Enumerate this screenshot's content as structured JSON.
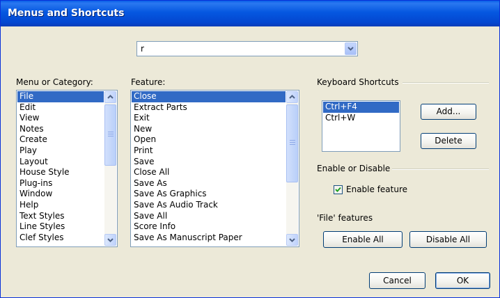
{
  "window": {
    "title": "Menus and Shortcuts"
  },
  "search": {
    "value": "r"
  },
  "menu_list": {
    "label": "Menu or Category:",
    "selected": "File",
    "items": [
      "File",
      "Edit",
      "View",
      "Notes",
      "Create",
      "Play",
      "Layout",
      "House Style",
      "Plug-ins",
      "Window",
      "Help",
      "Text Styles",
      "Line Styles",
      "Clef Styles"
    ]
  },
  "feature_list": {
    "label": "Feature:",
    "selected": "Close",
    "items": [
      "Close",
      "Extract Parts",
      "Exit",
      "New",
      "Open",
      "Print",
      "Save",
      "Close All",
      "Save As",
      "Save As Graphics",
      "Save As Audio Track",
      "Save All",
      "Score Info",
      "Save As Manuscript Paper"
    ]
  },
  "shortcuts": {
    "group_label": "Keyboard Shortcuts",
    "items": [
      "Ctrl+F4",
      "Ctrl+W"
    ],
    "selected": "Ctrl+F4",
    "add_label": "Add...",
    "delete_label": "Delete"
  },
  "enable": {
    "group_label": "Enable or Disable",
    "checkbox_label": "Enable feature",
    "checked": true,
    "features_label": "'File' features",
    "enable_all_label": "Enable All",
    "disable_all_label": "Disable All"
  },
  "footer": {
    "cancel_label": "Cancel",
    "ok_label": "OK"
  }
}
